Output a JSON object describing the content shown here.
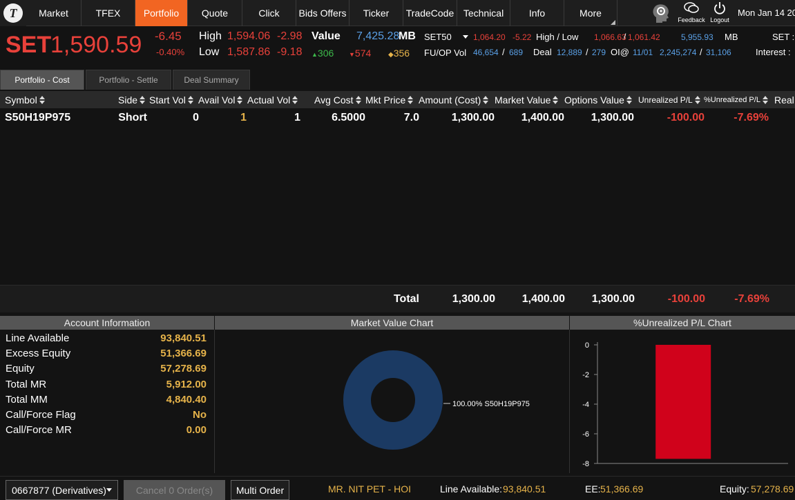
{
  "nav": {
    "items": [
      "Market",
      "TFEX",
      "Portfolio",
      "Quote",
      "Click",
      "Bids Offers",
      "Ticker",
      "TradeCode",
      "Technical",
      "Info",
      "More"
    ],
    "active": "Portfolio",
    "feedback_label": "Feedback",
    "logout_label": "Logout",
    "date": "Mon Jan 14 20"
  },
  "index": {
    "name": "SET",
    "value": "1,590.59",
    "change": "-6.45",
    "change_pct": "-0.40%",
    "high_label": "High",
    "high": "1,594.06",
    "high_change": "-2.98",
    "low_label": "Low",
    "low": "1,587.86",
    "low_change": "-9.18",
    "value_label": "Value",
    "value_amount": "7,425.28",
    "value_unit": "MB",
    "up": "306",
    "down": "574",
    "unchanged": "356",
    "set50_label": "SET50",
    "set50_value": "1,064.20",
    "set50_change": "-5.22",
    "highlow_label": "High / Low",
    "set50_high": "1,066.63",
    "set50_low": "1,061.42",
    "set50_val": "5,955.93",
    "set50_unit": "MB",
    "set_colon": "SET :",
    "fuop_label": "FU/OP Vol",
    "fuop_a": "46,654",
    "fuop_b": "689",
    "deal_label": "Deal",
    "deal_a": "12,889",
    "deal_b": "279",
    "oi_label": "OI@",
    "oi_date": "11/01",
    "oi_a": "2,245,274",
    "oi_b": "31,106",
    "interest_label": "Interest :"
  },
  "tabs": [
    "Portfolio - Cost",
    "Portfolio - Settle",
    "Deal Summary"
  ],
  "table": {
    "headers": [
      "Symbol",
      "Side",
      "Start Vol",
      "Avail Vol",
      "Actual Vol",
      "Avg Cost",
      "Mkt Price",
      "Amount (Cost)",
      "Market Value",
      "Options Value",
      "Unrealized P/L",
      "%Unrealized P/L",
      "Real"
    ],
    "rows": [
      {
        "symbol": "S50H19P975",
        "side": "Short",
        "start_vol": "0",
        "avail_vol": "1",
        "actual_vol": "1",
        "avg_cost": "6.5000",
        "mkt_price": "7.0",
        "amount_cost": "1,300.00",
        "market_value": "1,400.00",
        "options_value": "1,300.00",
        "unrealized_pl": "-100.00",
        "pct_unrealized_pl": "-7.69%"
      }
    ],
    "total": {
      "label": "Total",
      "amount_cost": "1,300.00",
      "market_value": "1,400.00",
      "options_value": "1,300.00",
      "unrealized_pl": "-100.00",
      "pct_unrealized_pl": "-7.69%"
    }
  },
  "account": {
    "title": "Account Information",
    "items": [
      {
        "label": "Line Available",
        "value": "93,840.51"
      },
      {
        "label": "Excess Equity",
        "value": "51,366.69"
      },
      {
        "label": "Equity",
        "value": "57,278.69"
      },
      {
        "label": "Total MR",
        "value": "5,912.00"
      },
      {
        "label": "Total MM",
        "value": "4,840.40"
      },
      {
        "label": "Call/Force Flag",
        "value": "No"
      },
      {
        "label": "Call/Force MR",
        "value": "0.00"
      }
    ]
  },
  "charts_titles": {
    "market_value": "Market Value Chart",
    "unrealized": "%Unrealized P/L Chart"
  },
  "chart_data": [
    {
      "type": "pie",
      "title": "Market Value Chart",
      "categories": [
        "S50H19P975"
      ],
      "values": [
        100.0
      ],
      "labels": [
        "100.00% S50H19P975"
      ],
      "colors": [
        "#1b3a63"
      ]
    },
    {
      "type": "bar",
      "title": "%Unrealized P/L Chart",
      "categories": [
        "S50H19P975"
      ],
      "values": [
        -7.69
      ],
      "ylim": [
        -8,
        0
      ],
      "yticks": [
        "0",
        "-2",
        "-4",
        "-6",
        "-8"
      ],
      "colors": [
        "#d0021b"
      ]
    }
  ],
  "footer": {
    "account_select": "0667877 (Derivatives)",
    "cancel_label": "Cancel 0 Order(s)",
    "multi_order_label": "Multi Order",
    "user": "MR. NIT PET - HOI",
    "line_available_label": "Line Available:",
    "line_available": "93,840.51",
    "ee_label": "EE:",
    "ee": "51,366.69",
    "equity_label": "Equity:",
    "equity": "57,278.69"
  }
}
